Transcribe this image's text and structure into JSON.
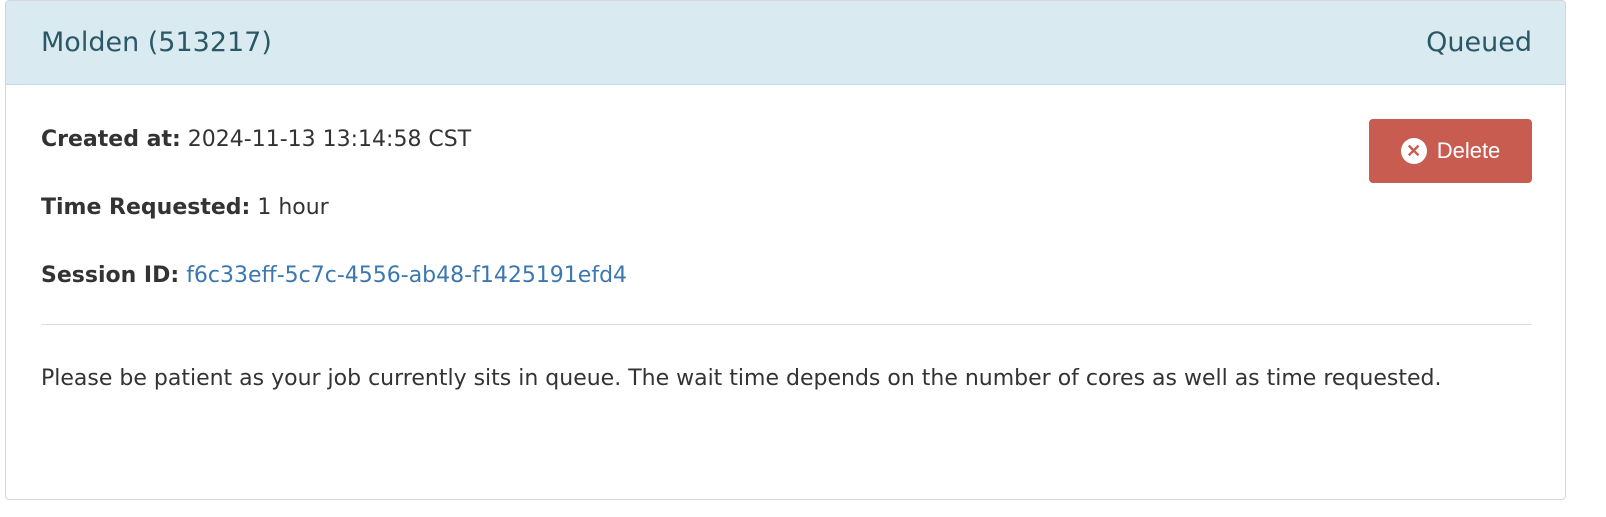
{
  "panel": {
    "title": "Molden (513217)",
    "status": "Queued"
  },
  "details": {
    "created_label": "Created at:",
    "created_value": "2024-11-13 13:14:58 CST",
    "time_label": "Time Requested:",
    "time_value": "1 hour",
    "session_label": "Session ID:",
    "session_value": "f6c33eff-5c7c-4556-ab48-f1425191efd4"
  },
  "delete_label": "Delete",
  "message": "Please be patient as your job currently sits in queue. The wait time depends on the number of cores as well as time requested."
}
